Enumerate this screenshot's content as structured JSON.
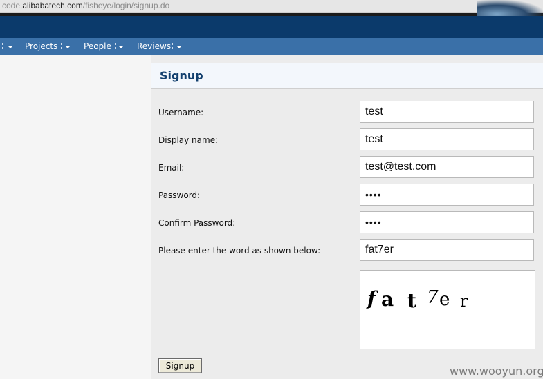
{
  "browser": {
    "url_prefix": "code.",
    "url_domain": "alibabatech.com",
    "url_path": "/fisheye/login/signup.do"
  },
  "nav": {
    "items": [
      {
        "label": "Projects"
      },
      {
        "label": "People"
      },
      {
        "label": "Reviews"
      }
    ]
  },
  "form": {
    "title": "Signup",
    "fields": [
      {
        "label": "Username:",
        "value": "test"
      },
      {
        "label": "Display name:",
        "value": "test"
      },
      {
        "label": "Email:",
        "value": "test@test.com"
      },
      {
        "label": "Password:",
        "value": "••••"
      },
      {
        "label": "Confirm Password:",
        "value": "••••"
      },
      {
        "label": "Please enter the word as shown below:",
        "value": "fat7er"
      }
    ],
    "captcha_word": "fat7er",
    "submit_label": "Signup"
  },
  "watermark": "www.wooyun.org",
  "colors": {
    "header_bg": "#0b3a6b",
    "nav_bg": "#3a70a8",
    "title_color": "#13406e"
  }
}
